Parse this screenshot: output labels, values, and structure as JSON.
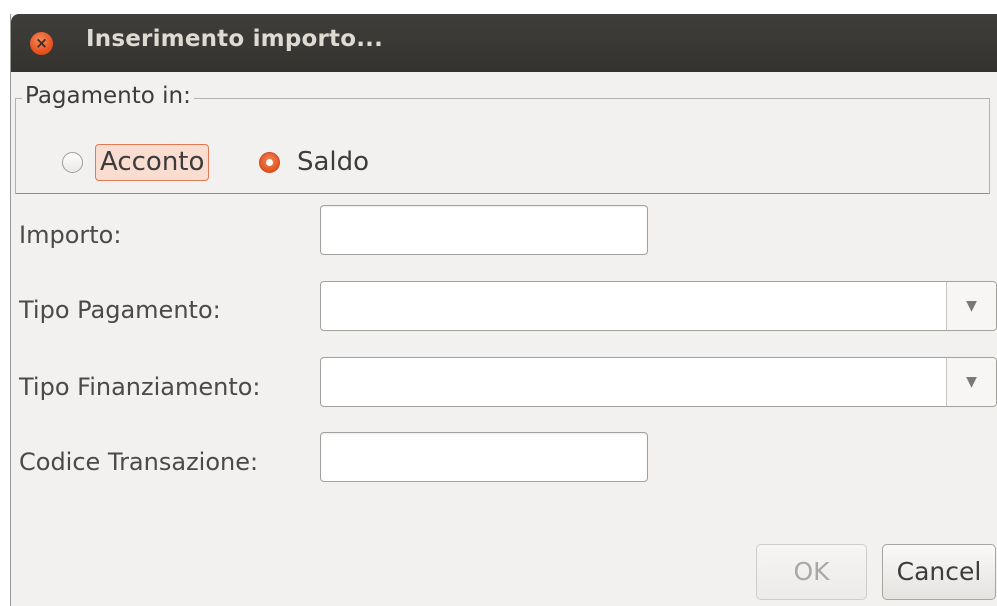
{
  "window": {
    "title": "Inserimento importo..."
  },
  "payment_group": {
    "legend": "Pagamento in:",
    "options": [
      {
        "label": "Acconto",
        "checked": false,
        "focused": true
      },
      {
        "label": "Saldo",
        "checked": true,
        "focused": false
      }
    ]
  },
  "form": {
    "importo": {
      "label": "Importo:",
      "value": ""
    },
    "tipo_pagamento": {
      "label": "Tipo Pagamento:",
      "value": ""
    },
    "tipo_finanziamento": {
      "label": "Tipo Finanziamento:",
      "value": ""
    },
    "codice_transazione": {
      "label": "Codice Transazione:",
      "value": ""
    }
  },
  "buttons": {
    "ok": {
      "label": "OK",
      "enabled": false
    },
    "cancel": {
      "label": "Cancel",
      "enabled": true
    }
  },
  "colors": {
    "accent": "#e95420",
    "titlebar": "#3c3b37",
    "window_bg": "#f2f1f0"
  },
  "icons": {
    "close": "close-icon",
    "dropdown": "chevron-down-icon"
  }
}
